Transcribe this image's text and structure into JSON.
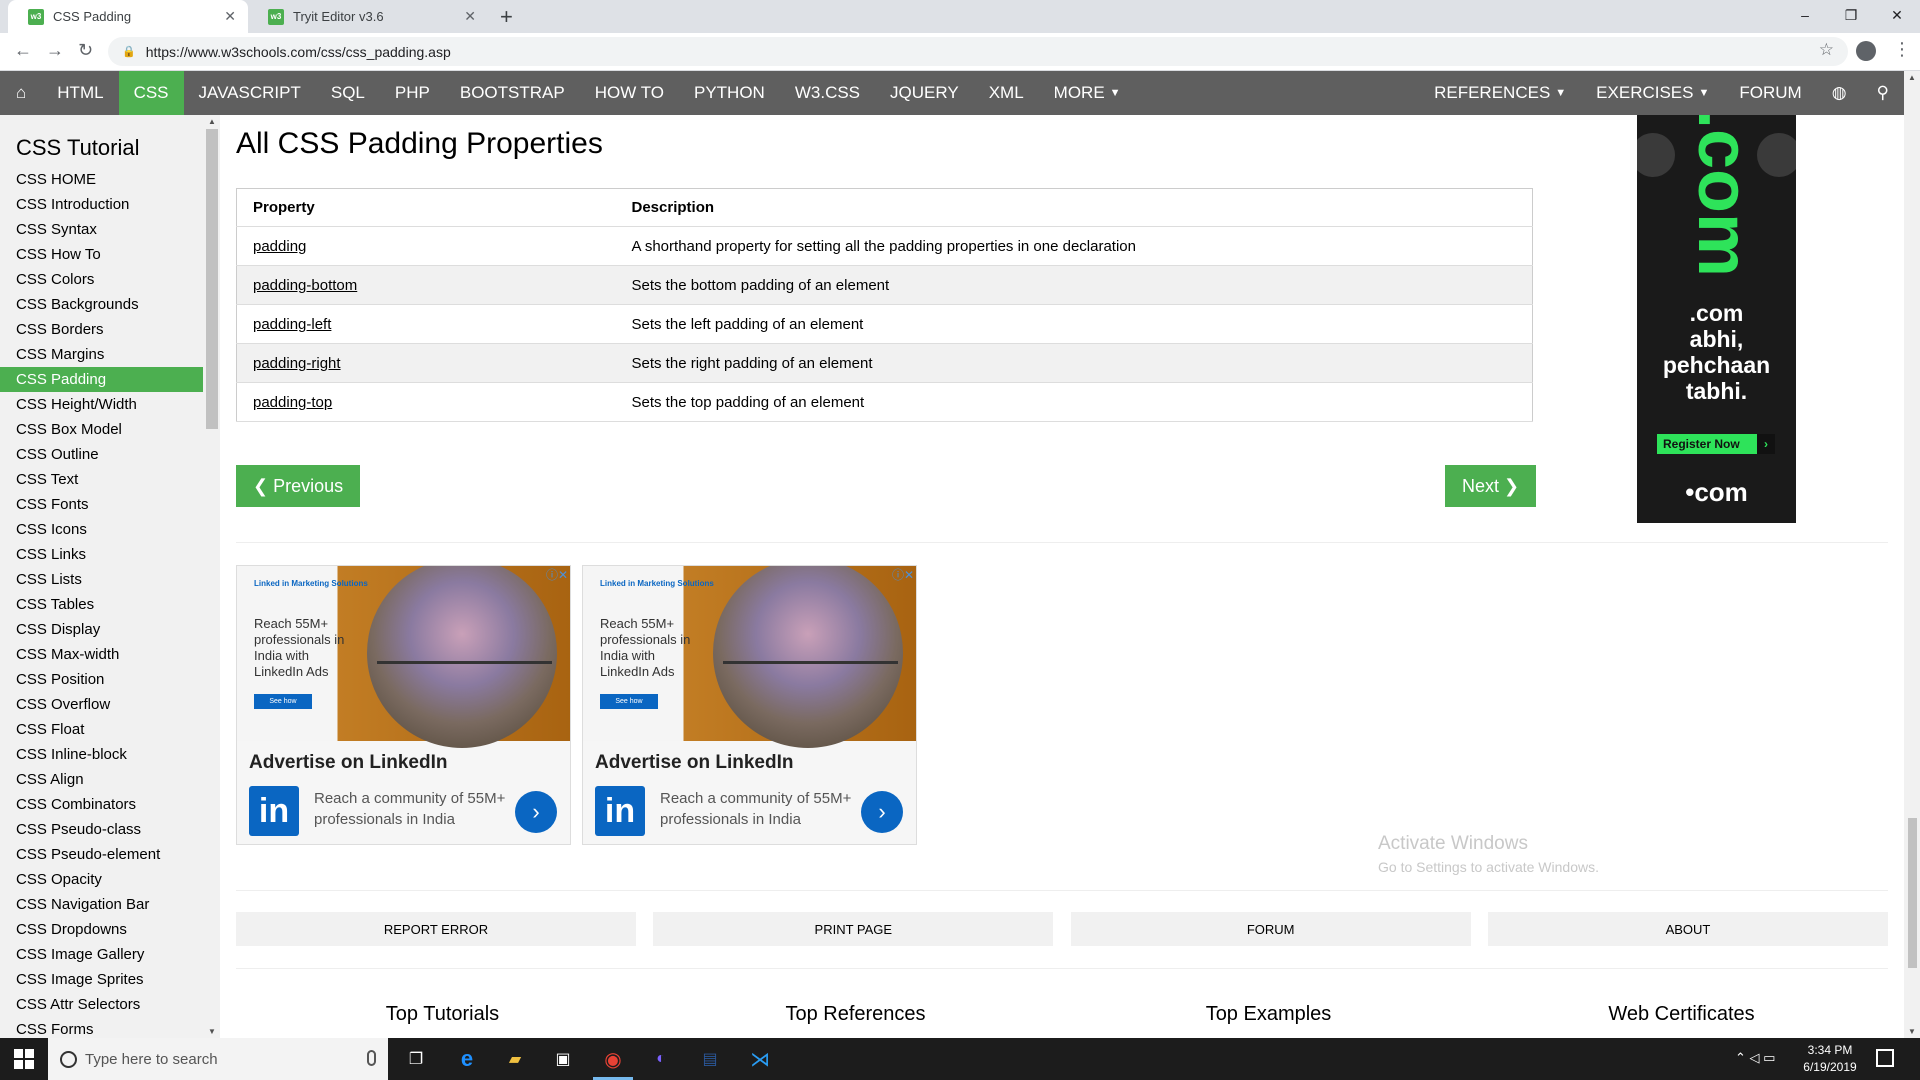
{
  "browser": {
    "tabs": [
      {
        "title": "CSS Padding",
        "active": true
      },
      {
        "title": "Tryit Editor v3.6",
        "active": false
      }
    ],
    "url": "https://www.w3schools.com/css/css_padding.asp",
    "window_controls": [
      "–",
      "❐",
      "✕"
    ]
  },
  "topnav": {
    "home_icon": "home-icon",
    "items": [
      "HTML",
      "CSS",
      "JAVASCRIPT",
      "SQL",
      "PHP",
      "BOOTSTRAP",
      "HOW TO",
      "PYTHON",
      "W3.CSS",
      "JQUERY",
      "XML",
      "MORE"
    ],
    "right_items": [
      "REFERENCES",
      "EXERCISES",
      "FORUM"
    ],
    "active": "CSS",
    "accent": "#4CAF50",
    "bar_color": "#5f5f5f"
  },
  "sidebar": {
    "title": "CSS Tutorial",
    "items": [
      "CSS HOME",
      "CSS Introduction",
      "CSS Syntax",
      "CSS How To",
      "CSS Colors",
      "CSS Backgrounds",
      "CSS Borders",
      "CSS Margins",
      "CSS Padding",
      "CSS Height/Width",
      "CSS Box Model",
      "CSS Outline",
      "CSS Text",
      "CSS Fonts",
      "CSS Icons",
      "CSS Links",
      "CSS Lists",
      "CSS Tables",
      "CSS Display",
      "CSS Max-width",
      "CSS Position",
      "CSS Overflow",
      "CSS Float",
      "CSS Inline-block",
      "CSS Align",
      "CSS Combinators",
      "CSS Pseudo-class",
      "CSS Pseudo-element",
      "CSS Opacity",
      "CSS Navigation Bar",
      "CSS Dropdowns",
      "CSS Image Gallery",
      "CSS Image Sprites",
      "CSS Attr Selectors",
      "CSS Forms"
    ],
    "active_index": 8
  },
  "main": {
    "title": "All CSS Padding Properties",
    "table": {
      "headers": [
        "Property",
        "Description"
      ],
      "rows": [
        [
          "padding",
          "A shorthand property for setting all the padding properties in one declaration"
        ],
        [
          "padding-bottom",
          "Sets the bottom padding of an element"
        ],
        [
          "padding-left",
          "Sets the left padding of an element"
        ],
        [
          "padding-right",
          "Sets the right padding of an element"
        ],
        [
          "padding-top",
          "Sets the top padding of an element"
        ]
      ]
    },
    "prev_label": "❮ Previous",
    "next_label": "Next ❯"
  },
  "ads": {
    "linkedin": {
      "brand": "Linked in  Marketing Solutions",
      "reach_text": "Reach 55M+ professionals in India with LinkedIn Ads",
      "see_how": "See how",
      "headline": "Advertise on LinkedIn",
      "sub": "Reach a community of 55M+ professionals in India",
      "logo_text": "in",
      "badge": "ⓘ✕"
    },
    "right": {
      "big_text": ".com",
      "tagline_1": ".com",
      "tagline_2": "abhi,",
      "tagline_3": "pehchaan",
      "tagline_4": "tabhi.",
      "register": "Register Now",
      "footer": "•com"
    }
  },
  "footer": {
    "buttons": [
      "REPORT ERROR",
      "PRINT PAGE",
      "FORUM",
      "ABOUT"
    ],
    "columns": [
      "Top Tutorials",
      "Top References",
      "Top Examples",
      "Web Certificates"
    ]
  },
  "watermark": {
    "line1": "Activate Windows",
    "line2": "Go to Settings to activate Windows."
  },
  "taskbar": {
    "search_placeholder": "Type here to search",
    "time": "3:34 PM",
    "date": "6/19/2019"
  }
}
